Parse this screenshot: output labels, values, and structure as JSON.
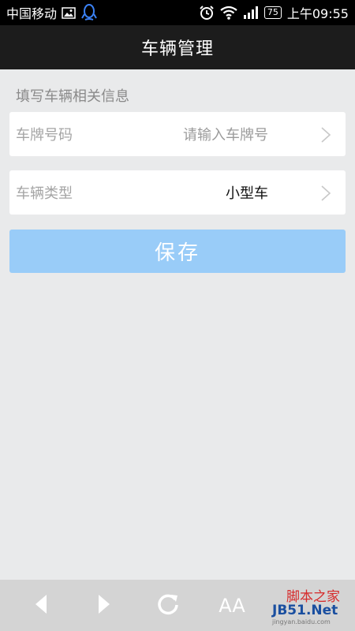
{
  "status_bar": {
    "carrier": "中国移动",
    "battery": "75",
    "time": "上午09:55"
  },
  "header": {
    "title": "车辆管理"
  },
  "form": {
    "section_heading": "填写车辆相关信息",
    "plate_label": "车牌号码",
    "plate_placeholder": "请输入车牌号",
    "type_label": "车辆类型",
    "type_value": "小型车",
    "save_label": "保存"
  },
  "bottom_bar": {
    "font_size_label": "AA"
  },
  "watermark": {
    "top": "脚本之家",
    "bottom": "JB51.Net",
    "small": "jingyan.baidu.com"
  },
  "colors": {
    "status_bar_bg": "#000000",
    "header_bg": "#1c1c1c",
    "page_bg": "#e9eaeb",
    "save_button_bg": "#99ccf8",
    "bottom_bar_bg": "#d4d4d4"
  },
  "icons": [
    "image-icon",
    "qq-icon",
    "alarm-icon",
    "wifi-icon",
    "signal-icon",
    "chevron-right-icon",
    "back-arrow-icon",
    "forward-arrow-icon",
    "refresh-icon"
  ]
}
